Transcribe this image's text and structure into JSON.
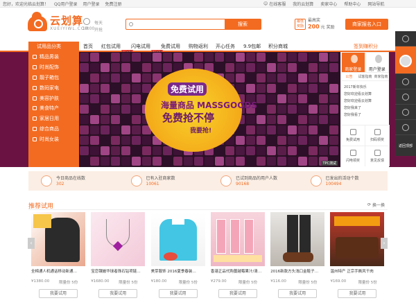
{
  "topbar": {
    "welcome": "您好，欢迎光临云划算！",
    "login_link": "用户登录",
    "free_register": "免费注册",
    "qq_login": "QQ用户登录",
    "online_service": "在线客服",
    "my_cloud": "我的云划算",
    "merchant_area": "卖家中心",
    "help_center": "帮助中心",
    "site_nav": "网站导航"
  },
  "header": {
    "logo_cn": "云划算",
    "logo_en": "XUEIYIWL.COM",
    "day_label": "每天",
    "time": "10:00",
    "open_label": "开抢",
    "search_placeholder": "",
    "search_button": "搜索",
    "badge_lowest": "最低 奖励",
    "lowest_label": "最高奖",
    "lowest_amount": "200",
    "lowest_unit": "元",
    "reward_label": "奖励",
    "merchant_button": "商家报名入口"
  },
  "nav": {
    "category_label": "试用品分类",
    "items": [
      {
        "label": "首页",
        "active": true,
        "hot": false
      },
      {
        "label": "红包试用",
        "active": false,
        "hot": true
      },
      {
        "label": "闪电试用",
        "active": false,
        "hot": true
      },
      {
        "label": "免费试用",
        "active": false,
        "hot": false
      },
      {
        "label": "购物返利",
        "active": false,
        "hot": false
      },
      {
        "label": "开心任务",
        "active": false,
        "hot": false
      },
      {
        "label": "9.9包邮",
        "active": false,
        "hot": false
      },
      {
        "label": "积分商城",
        "active": false,
        "hot": false
      }
    ],
    "hot_tag": "HOT",
    "daily_signin": "签到赚积分"
  },
  "sidebar": {
    "categories": [
      "精品男装",
      "时尚配饰",
      "靓子箱包",
      "数码家电",
      "美容护肤",
      "美食特产",
      "家居日用",
      "综合商品",
      "时尚女装"
    ]
  },
  "banner": {
    "line1": "免费试用",
    "line2": "海量商品 MASSGOODS",
    "line3": "免费抢不停",
    "line4": "我要抢!",
    "corner": "TPC测试"
  },
  "right_panel": {
    "tab_merchant": "商家登录",
    "tab_user": "用户登录",
    "sub_tabs": [
      "公告",
      "试客指南",
      "商家指南"
    ],
    "news": [
      "2017新年快乐",
      "您好欢迎看云划算",
      "您好欢迎看云划算",
      "您好我来了",
      "您好我看了"
    ],
    "grid": [
      "免费试用",
      "扫码领奖",
      "闪电领奖",
      "意见反馈"
    ]
  },
  "rail": {
    "bottom_label": "返回顶部"
  },
  "stats": [
    {
      "label": "今日商品在线数",
      "value": "302"
    },
    {
      "label": "已有入驻商家数",
      "value": "10061"
    },
    {
      "label": "已试到商品的用户人数",
      "value": "90168"
    },
    {
      "label": "已发出的活动个数",
      "value": "100494"
    }
  ],
  "recommend": {
    "title": "推荐试用",
    "refresh": "换一换",
    "arrow_left": "‹",
    "arrow_right": "›"
  },
  "products": [
    {
      "name": "全棉通人机通话移动新通…",
      "price": "¥1380.00",
      "limit": "限量份 5份",
      "button": "我要试用"
    },
    {
      "name": "宝恋镶嵌华球者珠石钻项链…",
      "price": "¥1680.00",
      "limit": "限量份 5份",
      "button": "我要试用"
    },
    {
      "name": "美芽服饰 2016夏季春装…",
      "price": "¥180.00",
      "limit": "限量份 5份",
      "button": "我要试用"
    },
    {
      "name": "香港正品代购蔓越莓果汁/清…",
      "price": "¥279.00",
      "limit": "限量份 5份",
      "button": "我要试用"
    },
    {
      "name": "2016新款方头浅口金鞋子…",
      "price": "¥116.00",
      "limit": "限量份 5份",
      "button": "我要试用"
    },
    {
      "name": "温州特产 正宗手撕风干肉",
      "price": "¥169.00",
      "limit": "限量份 5份",
      "button": "我要试用"
    }
  ]
}
